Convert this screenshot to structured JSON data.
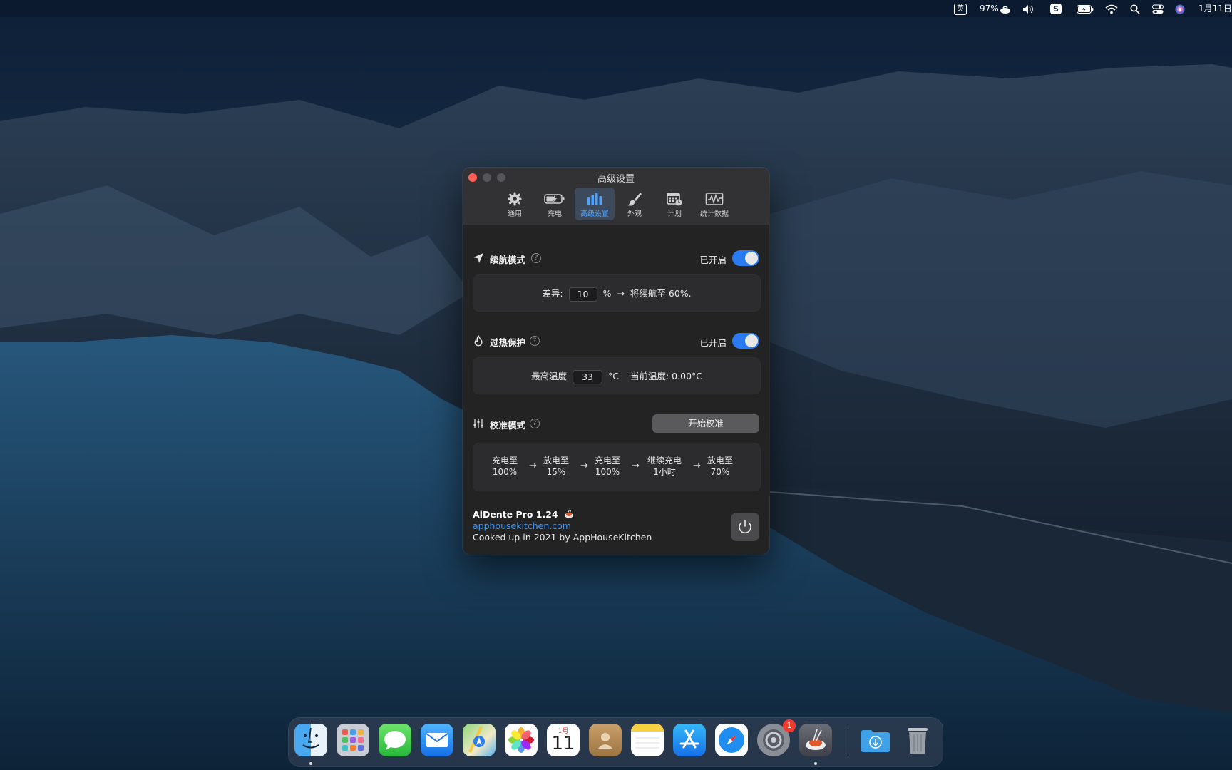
{
  "menubar": {
    "input_method": "英",
    "battery_percent": "97%",
    "date": "1月11日"
  },
  "window": {
    "title": "高级设置",
    "tabs": [
      {
        "label": "通用",
        "icon": "gear-icon"
      },
      {
        "label": "充电",
        "icon": "battery-charging-icon"
      },
      {
        "label": "高级设置",
        "icon": "bar-chart-icon",
        "active": true
      },
      {
        "label": "外观",
        "icon": "brush-icon"
      },
      {
        "label": "计划",
        "icon": "calendar-icon"
      },
      {
        "label": "统计数据",
        "icon": "stats-icon"
      }
    ]
  },
  "sailing": {
    "title": "续航模式",
    "help": "?",
    "status": "已开启",
    "enabled": true,
    "diff_label": "差异:",
    "diff_value": "10",
    "unit": "%",
    "arrow": "→",
    "result": "将续航至 60%."
  },
  "heat": {
    "title": "过热保护",
    "help": "?",
    "status": "已开启",
    "enabled": true,
    "max_label": "最高温度",
    "max_value": "33",
    "unit": "°C",
    "current_label": "当前温度: 0.00°C"
  },
  "calibration": {
    "title": "校准模式",
    "help": "?",
    "button": "开始校准",
    "steps": [
      {
        "line1": "充电至",
        "line2": "100%"
      },
      {
        "line1": "放电至",
        "line2": "15%"
      },
      {
        "line1": "充电至",
        "line2": "100%"
      },
      {
        "line1": "继续充电",
        "line2": "1小时"
      },
      {
        "line1": "放电至",
        "line2": "70%"
      }
    ],
    "arrow": "→"
  },
  "footer": {
    "app_name": "AlDente Pro 1.24",
    "link": "apphousekitchen.com",
    "credit": "Cooked up in 2021 by AppHouseKitchen"
  },
  "dock": {
    "apps": [
      "finder-icon",
      "launchpad-icon",
      "messages-icon",
      "mail-icon",
      "maps-icon",
      "photos-icon",
      "calendar-icon",
      "contacts-icon",
      "notes-icon",
      "app-store-icon",
      "safari-icon",
      "system-preferences-icon",
      "aldente-icon",
      "downloads-folder-icon",
      "trash-icon"
    ],
    "calendar_month": "1月",
    "calendar_day": "11",
    "settings_badge": "1"
  }
}
